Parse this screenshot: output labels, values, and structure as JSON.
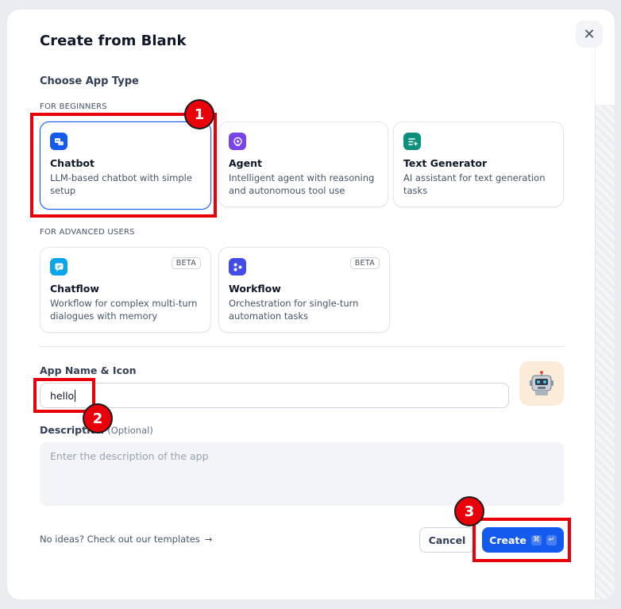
{
  "dialog": {
    "title": "Create from Blank",
    "close_icon": "close-icon"
  },
  "app_type": {
    "heading": "Choose App Type",
    "beginners_label": "FOR BEGINNERS",
    "advanced_label": "FOR ADVANCED USERS",
    "selected": "Chatbot",
    "cards": [
      {
        "title": "Chatbot",
        "desc": "LLM-based chatbot with simple setup",
        "icon": "chatbot-icon",
        "color": "#155aef",
        "badge": ""
      },
      {
        "title": "Agent",
        "desc": "Intelligent agent with reasoning and autonomous tool use",
        "icon": "agent-icon",
        "color": "#7a45e6",
        "badge": ""
      },
      {
        "title": "Text Generator",
        "desc": "AI assistant for text generation tasks",
        "icon": "text-generator-icon",
        "color": "#0e8f7e",
        "badge": ""
      },
      {
        "title": "Chatflow",
        "desc": "Workflow for complex multi-turn dialogues with memory",
        "icon": "chatflow-icon",
        "color": "#0ba5ec",
        "badge": "BETA"
      },
      {
        "title": "Workflow",
        "desc": "Orchestration for single-turn automation tasks",
        "icon": "workflow-icon",
        "color": "#444ce7",
        "badge": "BETA"
      }
    ]
  },
  "form": {
    "name_label": "App Name & Icon",
    "name_value": "hello",
    "app_icon": "robot-emoji",
    "app_icon_glyph": "🤖",
    "description_label": "Description",
    "description_optional": "(Optional)",
    "description_placeholder": "Enter the description of the app"
  },
  "footer": {
    "templates_link": "No ideas? Check out our templates",
    "cancel_label": "Cancel",
    "create_label": "Create",
    "create_shortcut": [
      "⌘",
      "↵"
    ]
  },
  "annotations": {
    "markers": [
      "1",
      "2",
      "3"
    ],
    "color": "#e8000b"
  },
  "colors": {
    "primary": "#155aef"
  }
}
